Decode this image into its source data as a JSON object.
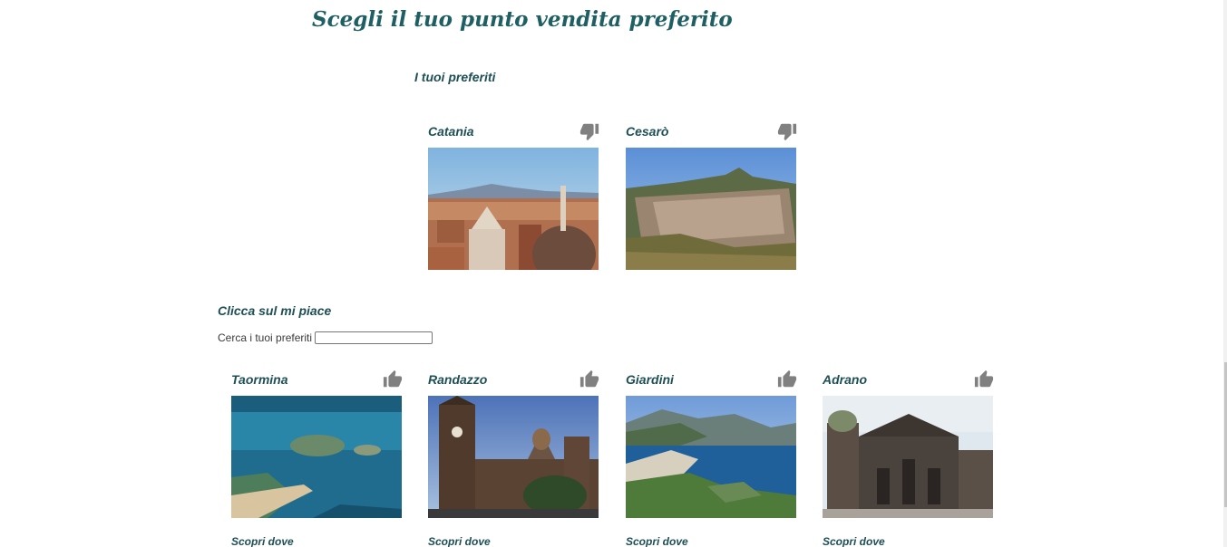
{
  "page": {
    "title": "Scegli il tuo punto vendita preferito"
  },
  "favorites": {
    "heading": "I tuoi preferiti",
    "items": [
      {
        "name": "Catania",
        "action_icon": "thumbs-down-icon"
      },
      {
        "name": "Cesarò",
        "action_icon": "thumbs-down-icon"
      }
    ]
  },
  "explore": {
    "heading": "Clicca sul mi piace",
    "search_label": "Cerca i tuoi preferiti",
    "search_value": "",
    "items": [
      {
        "name": "Taormina",
        "action_icon": "thumbs-up-icon",
        "link": "Scopri dove"
      },
      {
        "name": "Randazzo",
        "action_icon": "thumbs-up-icon",
        "link": "Scopri dove"
      },
      {
        "name": "Giardini",
        "action_icon": "thumbs-up-icon",
        "link": "Scopri dove"
      },
      {
        "name": "Adrano",
        "action_icon": "thumbs-up-icon",
        "link": "Scopri dove"
      }
    ]
  },
  "colors": {
    "title": "#1e5f63",
    "label": "#1e4f55",
    "icon": "#808080"
  }
}
